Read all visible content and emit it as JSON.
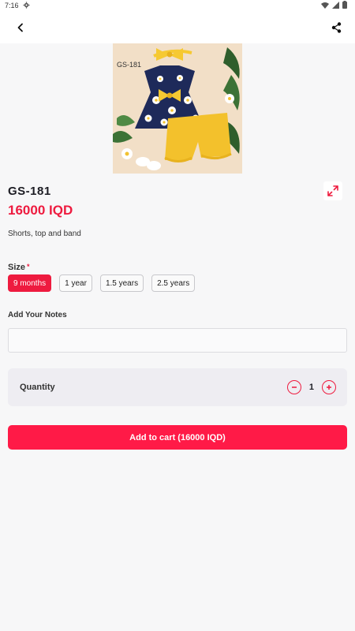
{
  "status_bar": {
    "time": "7:16",
    "icons": [
      "settings-icon",
      "wifi-icon",
      "signal-icon",
      "battery-icon"
    ]
  },
  "app_bar": {
    "back_icon": "chevron-left-icon",
    "share_icon": "share-icon"
  },
  "product": {
    "image_caption": "GS-181",
    "title": "GS-181",
    "price": "16000 IQD",
    "description": "Shorts, top and band",
    "expand_icon": "expand-icon"
  },
  "size": {
    "label": "Size",
    "required_mark": "*",
    "options": [
      "9 months",
      "1 year",
      "1.5 years",
      "2.5 years"
    ],
    "selected": "9 months"
  },
  "notes": {
    "label": "Add Your Notes",
    "value": "",
    "placeholder": ""
  },
  "quantity": {
    "label": "Quantity",
    "value": "1"
  },
  "cart_button": {
    "label": "Add to cart (16000 IQD)"
  },
  "colors": {
    "accent": "#ee1b3f",
    "button": "#ff1a47",
    "background": "#f7f7f8",
    "panel": "#eeedf2"
  }
}
